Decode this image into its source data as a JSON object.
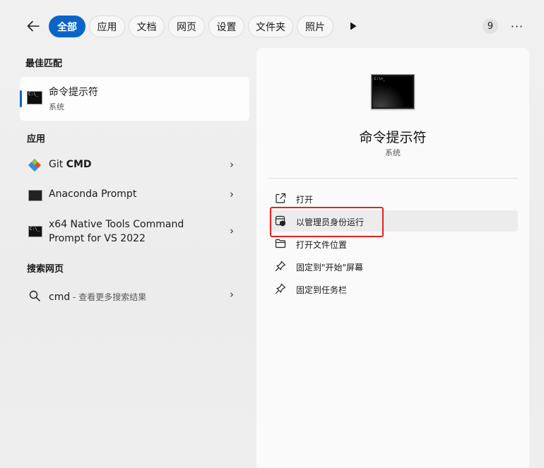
{
  "topbar": {
    "tabs": [
      {
        "label": "全部",
        "active": true
      },
      {
        "label": "应用",
        "active": false
      },
      {
        "label": "文档",
        "active": false
      },
      {
        "label": "网页",
        "active": false
      },
      {
        "label": "设置",
        "active": false
      },
      {
        "label": "文件夹",
        "active": false
      },
      {
        "label": "照片",
        "active": false
      }
    ],
    "badge_count": "9",
    "more_label": "···",
    "accent_color": "#0a64c8"
  },
  "best_match": {
    "section_title": "最佳匹配",
    "title": "命令提示符",
    "subtitle": "系统",
    "icon": "command-prompt-icon",
    "icon_text": "C:\\_"
  },
  "apps": {
    "section_title": "应用",
    "items": [
      {
        "name_plain": "Git ",
        "name_bold": "CMD",
        "icon": "git-icon"
      },
      {
        "name": "Anaconda Prompt",
        "icon": "anaconda-prompt-icon"
      },
      {
        "name_line1": "x64 Native Tools Command",
        "name_line2": "Prompt for VS 2022",
        "icon": "vs-tools-prompt-icon",
        "icon_text": "C:\\_"
      }
    ]
  },
  "web": {
    "section_title": "搜索网页",
    "query": "cmd",
    "suffix": " - 查看更多搜索结果"
  },
  "detail": {
    "title": "命令提示符",
    "subtitle": "系统",
    "icon_text": "C:\\>_",
    "actions": [
      {
        "label": "打开",
        "icon": "open-external-icon"
      },
      {
        "label": "以管理员身份运行",
        "icon": "shield-admin-icon",
        "highlighted": true
      },
      {
        "label": "打开文件位置",
        "icon": "folder-icon"
      },
      {
        "label": "固定到\"开始\"屏幕",
        "icon": "pin-icon"
      },
      {
        "label": "固定到任务栏",
        "icon": "pin-icon"
      }
    ],
    "highlight_color": "#e8201f"
  }
}
